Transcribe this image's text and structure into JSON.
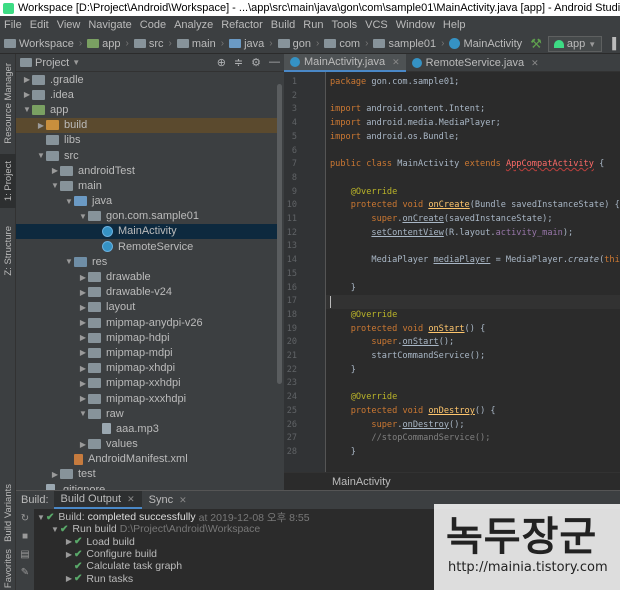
{
  "window_title": "Workspace [D:\\Project\\Android\\Workspace] - ...\\app\\src\\main\\java\\gon\\com\\sample01\\MainActivity.java [app] - Android Studio",
  "menu": [
    "File",
    "Edit",
    "View",
    "Navigate",
    "Code",
    "Analyze",
    "Refactor",
    "Build",
    "Run",
    "Tools",
    "VCS",
    "Window",
    "Help"
  ],
  "breadcrumbs": [
    "Workspace",
    "app",
    "src",
    "main",
    "java",
    "gon",
    "com",
    "sample01",
    "MainActivity"
  ],
  "run_config": "app",
  "left_tabs": [
    "Resource Manager",
    "1: Project",
    "Z: Structure"
  ],
  "bottom_left_tabs": [
    "Build Variants",
    "Favorites"
  ],
  "project_panel": {
    "selector": "Project",
    "tree": [
      {
        "label": ".gradle",
        "depth": 1,
        "icon": "folder",
        "arrow": "right"
      },
      {
        "label": ".idea",
        "depth": 1,
        "icon": "folder",
        "arrow": "right"
      },
      {
        "label": "app",
        "depth": 1,
        "icon": "module",
        "arrow": "down"
      },
      {
        "label": "build",
        "depth": 2,
        "icon": "folder-orange",
        "arrow": "right",
        "highlight": "orange"
      },
      {
        "label": "libs",
        "depth": 2,
        "icon": "folder",
        "arrow": ""
      },
      {
        "label": "src",
        "depth": 2,
        "icon": "folder",
        "arrow": "down"
      },
      {
        "label": "androidTest",
        "depth": 3,
        "icon": "folder",
        "arrow": "right"
      },
      {
        "label": "main",
        "depth": 3,
        "icon": "folder",
        "arrow": "down"
      },
      {
        "label": "java",
        "depth": 4,
        "icon": "folder-blue",
        "arrow": "down"
      },
      {
        "label": "gon.com.sample01",
        "depth": 5,
        "icon": "folder",
        "arrow": "down"
      },
      {
        "label": "MainActivity",
        "depth": 6,
        "icon": "cls",
        "arrow": "",
        "selected": true
      },
      {
        "label": "RemoteService",
        "depth": 6,
        "icon": "cls",
        "arrow": ""
      },
      {
        "label": "res",
        "depth": 4,
        "icon": "folder-src",
        "arrow": "down"
      },
      {
        "label": "drawable",
        "depth": 5,
        "icon": "folder",
        "arrow": "right"
      },
      {
        "label": "drawable-v24",
        "depth": 5,
        "icon": "folder",
        "arrow": "right"
      },
      {
        "label": "layout",
        "depth": 5,
        "icon": "folder",
        "arrow": "right"
      },
      {
        "label": "mipmap-anydpi-v26",
        "depth": 5,
        "icon": "folder",
        "arrow": "right"
      },
      {
        "label": "mipmap-hdpi",
        "depth": 5,
        "icon": "folder",
        "arrow": "right"
      },
      {
        "label": "mipmap-mdpi",
        "depth": 5,
        "icon": "folder",
        "arrow": "right"
      },
      {
        "label": "mipmap-xhdpi",
        "depth": 5,
        "icon": "folder",
        "arrow": "right"
      },
      {
        "label": "mipmap-xxhdpi",
        "depth": 5,
        "icon": "folder",
        "arrow": "right"
      },
      {
        "label": "mipmap-xxxhdpi",
        "depth": 5,
        "icon": "folder",
        "arrow": "right"
      },
      {
        "label": "raw",
        "depth": 5,
        "icon": "folder",
        "arrow": "down"
      },
      {
        "label": "aaa.mp3",
        "depth": 6,
        "icon": "file",
        "arrow": ""
      },
      {
        "label": "values",
        "depth": 5,
        "icon": "folder",
        "arrow": "right"
      },
      {
        "label": "AndroidManifest.xml",
        "depth": 4,
        "icon": "xml",
        "arrow": ""
      },
      {
        "label": "test",
        "depth": 3,
        "icon": "folder",
        "arrow": "right"
      },
      {
        "label": ".gitignore",
        "depth": 2,
        "icon": "file",
        "arrow": ""
      }
    ]
  },
  "editor": {
    "tabs": [
      {
        "label": "MainActivity.java",
        "active": true
      },
      {
        "label": "RemoteService.java",
        "active": false
      }
    ],
    "breadcrumb": "MainActivity",
    "line_numbers": [
      "1",
      "2",
      "3",
      "4",
      "5",
      "6",
      "7",
      "8",
      "9",
      "10",
      "11",
      "12",
      "13",
      "14",
      "15",
      "16",
      "17",
      "18",
      "19",
      "20",
      "21",
      "22",
      "23",
      "24",
      "25",
      "26",
      "27",
      "28"
    ],
    "code": [
      "<span class=\"kw\">package</span> gon.com.sample01;",
      "",
      "<span class=\"kw\">import</span> android.content.Intent;",
      "<span class=\"kw\">import</span> android.media.MediaPlayer;",
      "<span class=\"kw\">import</span> android.os.Bundle;",
      "",
      "<span class=\"kw\">public class</span> MainActivity <span class=\"kw\">extends</span> <span class=\"red\">AppCompatActivity</span> {",
      "",
      "    <span class=\"an\">@Override</span>",
      "    <span class=\"kw\">protected void</span> <span class=\"ov\">onCreate</span>(Bundle savedInstanceState) {",
      "        <span class=\"kw\">super</span>.<span class=\"ul\">onCreate</span>(savedInstanceState);",
      "        <span class=\"ul\">setContentView</span>(R.layout.<span class=\"fd\">activity_main</span>);",
      "",
      "        MediaPlayer <span class=\"ul\">mediaPlayer</span> = MediaPlayer.<i>create</i>(<span class=\"kw\">this</span>, R.raw.<span class=\"fd\">aaa</span>",
      "",
      "    }",
      "",
      "    <span class=\"an\">@Override</span>",
      "    <span class=\"kw\">protected void</span> <span class=\"ov\">onStart</span>() {",
      "        <span class=\"kw\">super</span>.<span class=\"ul\">onStart</span>();",
      "        startCommandService();",
      "    }",
      "",
      "    <span class=\"an\">@Override</span>",
      "    <span class=\"kw\">protected void</span> <span class=\"ov\">onDestroy</span>() {",
      "        <span class=\"kw\">super</span>.<span class=\"ul\">onDestroy</span>();",
      "        <span class=\"cm\">//stopCommandService();</span>",
      "    }"
    ]
  },
  "build": {
    "tab_label": "Build:",
    "tabs": [
      "Build Output",
      "Sync"
    ],
    "rows": [
      {
        "depth": 0,
        "text": "Build:",
        "bold": "completed successfully",
        "muted": "at 2019-12-08 오후 8:55",
        "arrow": "down"
      },
      {
        "depth": 1,
        "text": "Run build",
        "muted": "D:\\Project\\Android\\Workspace",
        "arrow": "down"
      },
      {
        "depth": 2,
        "text": "Load build",
        "arrow": "right"
      },
      {
        "depth": 2,
        "text": "Configure build",
        "arrow": "right"
      },
      {
        "depth": 2,
        "text": "Calculate task graph",
        "arrow": ""
      },
      {
        "depth": 2,
        "text": "Run tasks",
        "arrow": "right"
      }
    ]
  },
  "watermark": {
    "title": "녹두장군",
    "url": "http://mainia.tistory.com"
  }
}
